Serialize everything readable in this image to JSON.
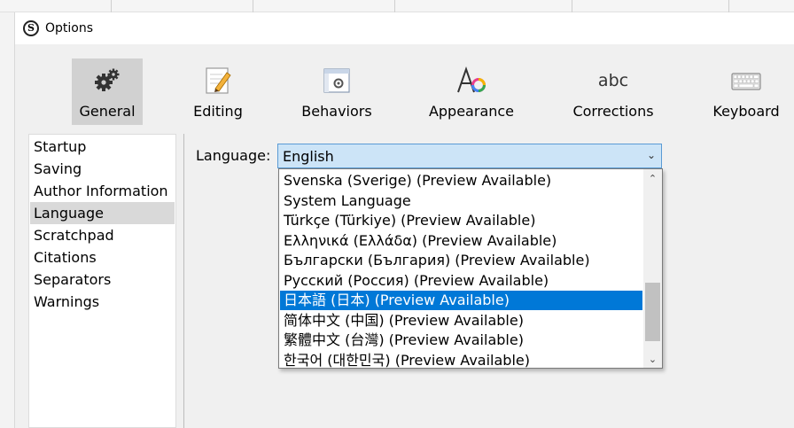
{
  "window": {
    "title": "Options"
  },
  "toolbar": {
    "items": [
      {
        "label": "General",
        "icon": "gears-icon",
        "active": true
      },
      {
        "label": "Editing",
        "icon": "pencil-document-icon"
      },
      {
        "label": "Behaviors",
        "icon": "window-gear-icon"
      },
      {
        "label": "Appearance",
        "icon": "font-color-icon"
      },
      {
        "label": "Corrections",
        "icon": "abc-icon",
        "icon_text": "abc"
      },
      {
        "label": "Keyboard",
        "icon": "keyboard-icon"
      }
    ]
  },
  "sidebar": {
    "items": [
      {
        "label": "Startup"
      },
      {
        "label": "Saving"
      },
      {
        "label": "Author Information"
      },
      {
        "label": "Language",
        "selected": true
      },
      {
        "label": "Scratchpad"
      },
      {
        "label": "Citations"
      },
      {
        "label": "Separators"
      },
      {
        "label": "Warnings"
      }
    ]
  },
  "language": {
    "label": "Language:",
    "selected_value": "English",
    "options": [
      "Svenska (Sverige) (Preview Available)",
      "System Language",
      "Türkçe (Türkiye) (Preview Available)",
      "Ελληνικά (Ελλάδα) (Preview Available)",
      "Български (България) (Preview Available)",
      "Русский (Россия) (Preview Available)",
      "日本語 (日本) (Preview Available)",
      "简体中文 (中国) (Preview Available)",
      "繁體中文 (台灣) (Preview Available)",
      "한국어 (대한민국) (Preview Available)"
    ],
    "highlighted_index": 6
  },
  "colors": {
    "dialog_bg": "#f0f0f0",
    "active_tool_bg": "#d1d1d1",
    "combo_bg": "#cce4f7",
    "highlight": "#0078d7"
  }
}
